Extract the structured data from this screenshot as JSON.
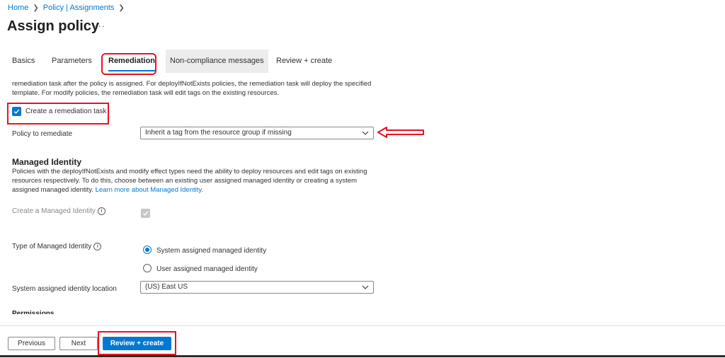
{
  "breadcrumb": {
    "home": "Home",
    "policy": "Policy | Assignments"
  },
  "page": {
    "title": "Assign policy",
    "more": "···"
  },
  "tabs": [
    {
      "label": "Basics"
    },
    {
      "label": "Parameters"
    },
    {
      "label": "Remediation"
    },
    {
      "label": "Non-compliance messages"
    },
    {
      "label": "Review + create"
    }
  ],
  "remediation": {
    "description": "remediation task after the policy is assigned. For deployIfNotExists policies, the remediation task will deploy the specified template. For modify policies, the remediation task will edit tags on the existing resources.",
    "create_task_label": "Create a remediation task",
    "policy_label": "Policy to remediate",
    "policy_value": "Inherit a tag from the resource group if missing"
  },
  "managed_identity": {
    "title": "Managed Identity",
    "description": "Policies with the deployIfNotExists and modify effect types need the ability to deploy resources and edit tags on existing resources respectively. To do this, choose between an existing user assigned managed identity or creating a system assigned managed identity.",
    "learn_more": "Learn more about Managed Identity.",
    "create_label": "Create a Managed Identity",
    "type_label": "Type of Managed Identity",
    "option_system": "System assigned managed identity",
    "option_user": "User assigned managed identity",
    "location_label": "System assigned identity location",
    "location_value": "(US) East US",
    "permissions_cutoff": "Permissions"
  },
  "footer": {
    "previous": "Previous",
    "next": "Next",
    "review": "Review + create"
  },
  "colors": {
    "accent": "#0078d4",
    "annotation": "#e81123"
  }
}
